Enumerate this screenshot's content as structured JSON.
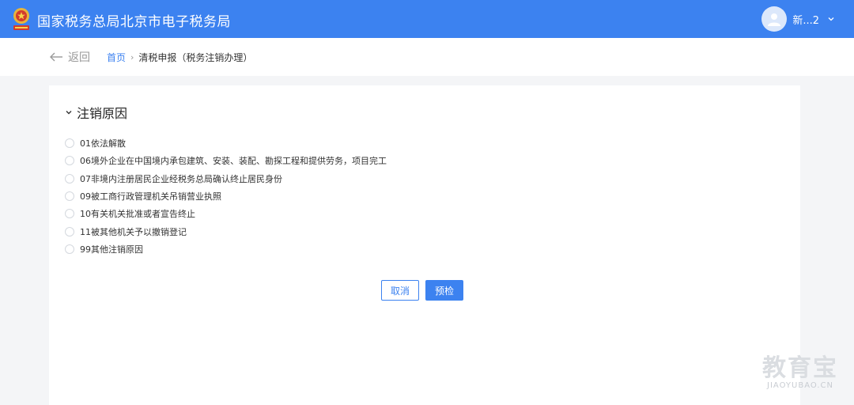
{
  "header": {
    "title": "国家税务总局北京市电子税务局",
    "user_name": "新...2",
    "bg_color": "#3c82f0"
  },
  "nav": {
    "back_label": "返回",
    "breadcrumb": {
      "home": "首页",
      "separator": "›",
      "current": "清税申报（税务注销办理）"
    }
  },
  "section": {
    "title": "注销原因",
    "options": [
      "01依法解散",
      "06境外企业在中国境内承包建筑、安装、装配、勘探工程和提供劳务，项目完工",
      "07非境内注册居民企业经税务总局确认终止居民身份",
      "09被工商行政管理机关吊销营业执照",
      "10有关机关批准或者宣告终止",
      "11被其他机关予以撤销登记",
      "99其他注销原因"
    ]
  },
  "actions": {
    "cancel_label": "取消",
    "precheck_label": "预检"
  },
  "watermark": {
    "cn": "教育宝",
    "en": "JIAOYUBAO.CN"
  }
}
